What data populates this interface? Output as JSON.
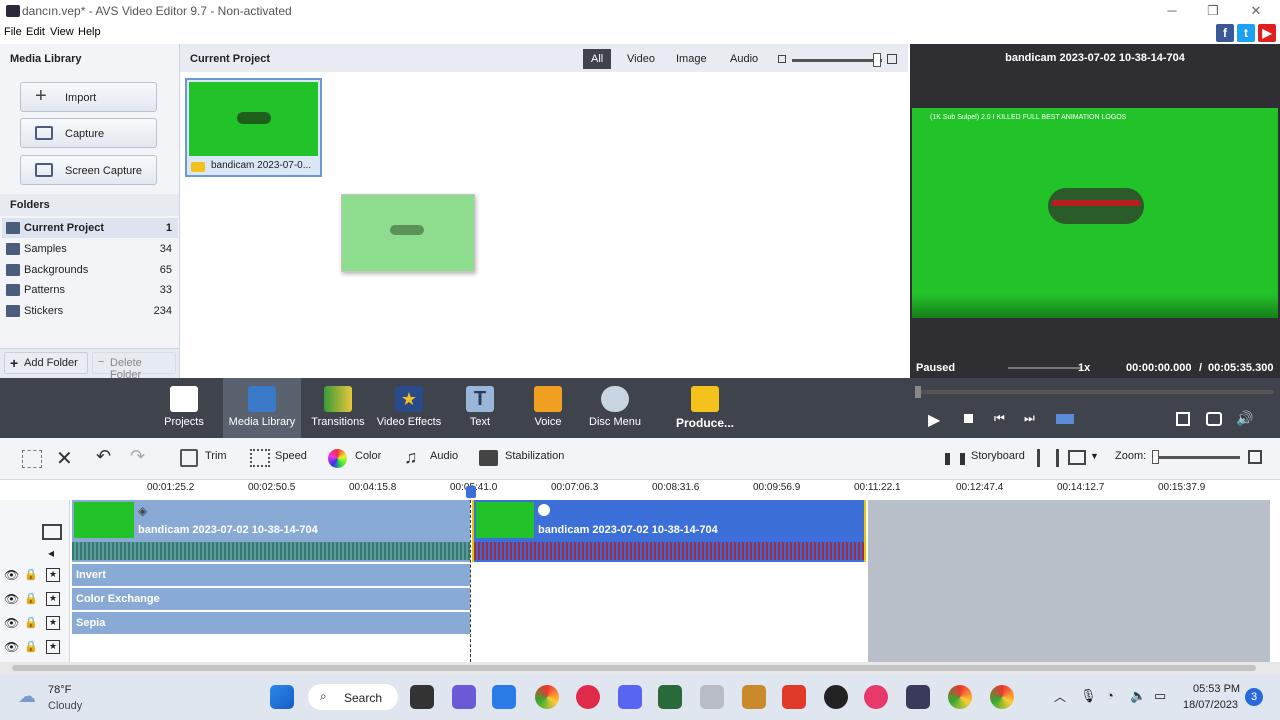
{
  "window": {
    "title": "dancın.vep* - AVS Video Editor 9.7 - Non-activated",
    "min": "─",
    "max": "❐",
    "close": "✕"
  },
  "menu": [
    "File",
    "Edit",
    "View",
    "Help"
  ],
  "media_library": {
    "title": "Media Library",
    "buttons": [
      "Import",
      "Capture",
      "Screen Capture"
    ],
    "folders_title": "Folders",
    "folders": [
      {
        "name": "Current Project",
        "count": "1"
      },
      {
        "name": "Samples",
        "count": "34"
      },
      {
        "name": "Backgrounds",
        "count": "65"
      },
      {
        "name": "Patterns",
        "count": "33"
      },
      {
        "name": "Stickers",
        "count": "234"
      }
    ],
    "add_folder": "Add Folder",
    "delete_folder": "Delete Folder"
  },
  "project": {
    "title": "Current Project",
    "filters": [
      "All",
      "Video",
      "Image",
      "Audio"
    ],
    "thumb_label": "bandicam 2023-07-0..."
  },
  "preview": {
    "title": "bandicam 2023-07-02 10-38-14-704",
    "overlay_text": "(1K Sub Sulpel) 2.0 I KILLED FULL BEST ANIMATION LOGOS",
    "status": "Paused",
    "speed": "1x",
    "current_time": "00:00:00.000",
    "separator": "/",
    "total_time": "00:05:35.300"
  },
  "toolbar": [
    "Projects",
    "Media Library",
    "Transitions",
    "Video Effects",
    "Text",
    "Voice",
    "Disc Menu",
    "Produce..."
  ],
  "timeline_tools": {
    "trim": "Trim",
    "speed": "Speed",
    "color": "Color",
    "audio": "Audio",
    "stabilization": "Stabilization",
    "storyboard": "Storyboard",
    "zoom": "Zoom:"
  },
  "ruler": [
    "00:01:25.2",
    "00:02:50.5",
    "00:04:15.8",
    "00:05:41.0",
    "00:07:06.3",
    "00:08:31.6",
    "00:09:56.9",
    "00:11:22.1",
    "00:12:47.4",
    "00:14:12.7",
    "00:15:37.9"
  ],
  "clips": [
    "bandicam 2023-07-02 10-38-14-704",
    "bandicam 2023-07-02 10-38-14-704"
  ],
  "effects": [
    "Invert",
    "Color Exchange",
    "Sepia"
  ],
  "taskbar": {
    "temp": "78°F",
    "weather": "Cloudy",
    "search": "Search",
    "time": "05:53 PM",
    "date": "18/07/2023",
    "badge": "3"
  },
  "colors": {
    "accent": "#3c6fd8",
    "clip_dark": "#4c79d0",
    "clip_light": "#8aaad6",
    "green": "#22c229",
    "toolbar": "#3f434b"
  }
}
